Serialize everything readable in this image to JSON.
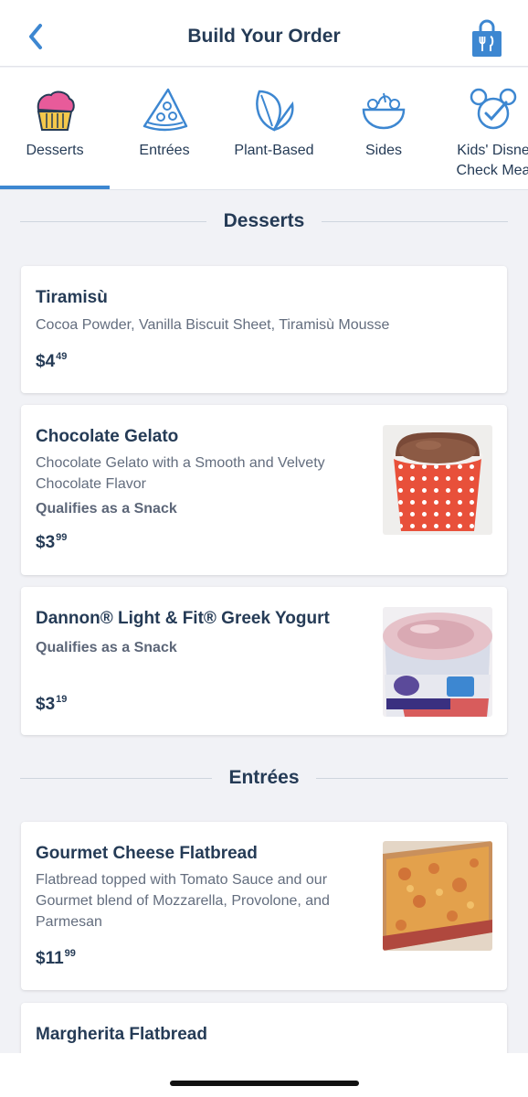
{
  "header": {
    "title": "Build Your Order",
    "back_icon": "chevron-left-icon",
    "bag_icon": "shopping-bag-icon"
  },
  "tabs": [
    {
      "label": "Desserts",
      "icon": "cupcake-icon",
      "selected": true
    },
    {
      "label": "Entrées",
      "icon": "pizza-slice-icon",
      "selected": false
    },
    {
      "label": "Plant-Based",
      "icon": "leaf-icon",
      "selected": false
    },
    {
      "label": "Sides",
      "icon": "salad-bowl-icon",
      "selected": false
    },
    {
      "label": "Kids' Disne\nCheck Mea",
      "icon": "mickey-check-icon",
      "selected": false
    }
  ],
  "sections": [
    {
      "title": "Desserts",
      "items": [
        {
          "name": "Tiramisù",
          "description": "Cocoa Powder, Vanilla Biscuit Sheet, Tiramisù Mousse",
          "price_dollars": "$4",
          "price_cents": "49"
        },
        {
          "name": "Chocolate Gelato",
          "description_line1": "Chocolate Gelato with a Smooth and Velvety",
          "description_line2": "Chocolate Flavor",
          "snack": "Qualifies as a Snack",
          "price_dollars": "$3",
          "price_cents": "99"
        },
        {
          "name": "Dannon® Light & Fit® Greek Yogurt",
          "snack": "Qualifies as a Snack",
          "price_dollars": "$3",
          "price_cents": "19"
        }
      ]
    },
    {
      "title": "Entrées",
      "items": [
        {
          "name": "Gourmet Cheese Flatbread",
          "description_line1": "Flatbread topped with Tomato Sauce and our",
          "description_line2": "Gourmet blend of Mozzarella, Provolone, and",
          "description_line3": "Parmesan",
          "price_dollars": "$11",
          "price_cents": "99"
        },
        {
          "name": "Margherita Flatbread"
        }
      ]
    }
  ],
  "colors": {
    "accent": "#3d87d1",
    "navy": "#253b56",
    "cupcake_pink": "#e85b9a",
    "cupcake_cup": "#f5c84b",
    "gelato_cup": "#e8503a"
  }
}
